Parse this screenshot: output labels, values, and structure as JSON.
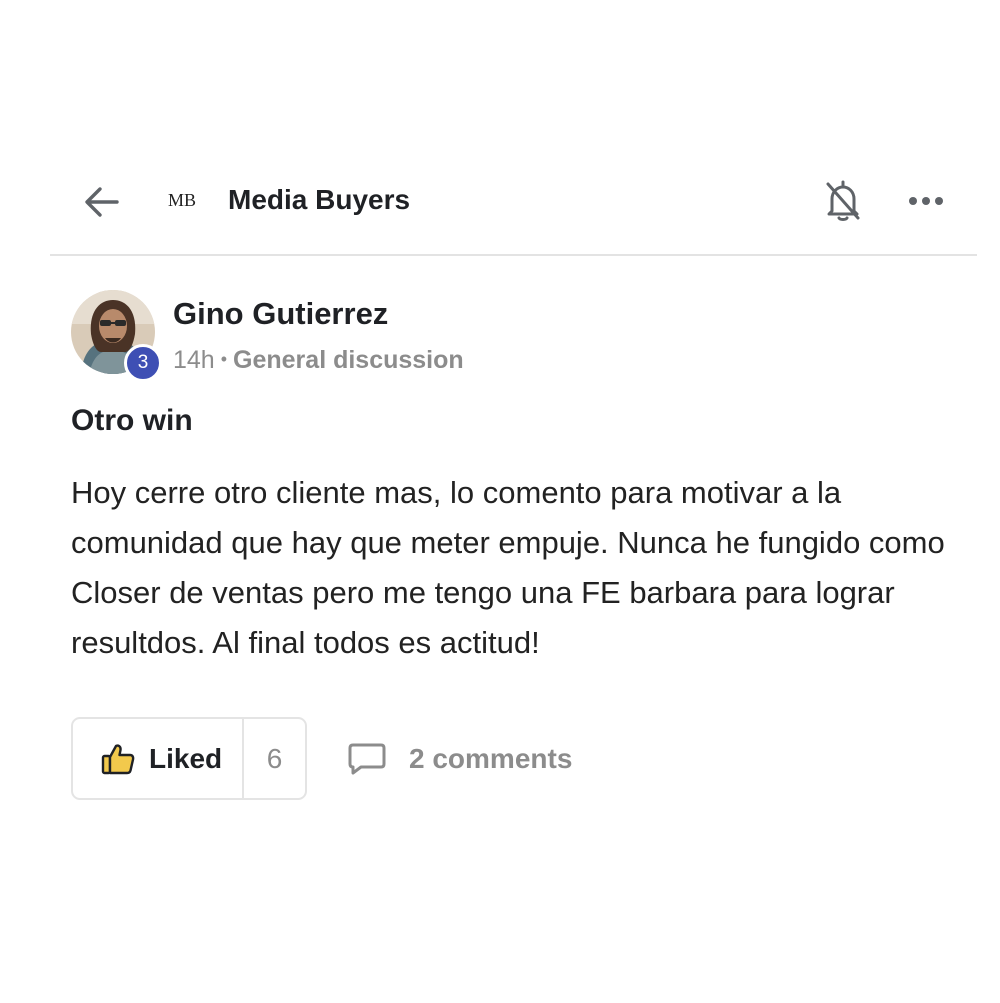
{
  "header": {
    "group_logo": "MB",
    "group_name": "Media Buyers",
    "icons": {
      "back": "back-arrow-icon",
      "notifications": "bell-off-icon",
      "more": "more-horizontal-icon"
    }
  },
  "post": {
    "author": {
      "name": "Gino Gutierrez",
      "level": "3"
    },
    "time_ago": "14h",
    "separator": "•",
    "category": "General discussion",
    "title": "Otro win",
    "body": "Hoy cerre otro cliente mas, lo comento para motivar a la comunidad que hay que meter empuje. Nunca he fungido como Closer de ventas pero me tengo una FE barbara para lograr resultdos. Al final todos es actitud!",
    "actions": {
      "like_label": "Liked",
      "like_count": "6",
      "comments_label": "2 comments"
    }
  },
  "colors": {
    "level_badge": "#3e4fb4",
    "liked_icon": "#f2c94c",
    "muted_text": "#8c8c8c",
    "divider": "#e3e3e3"
  }
}
